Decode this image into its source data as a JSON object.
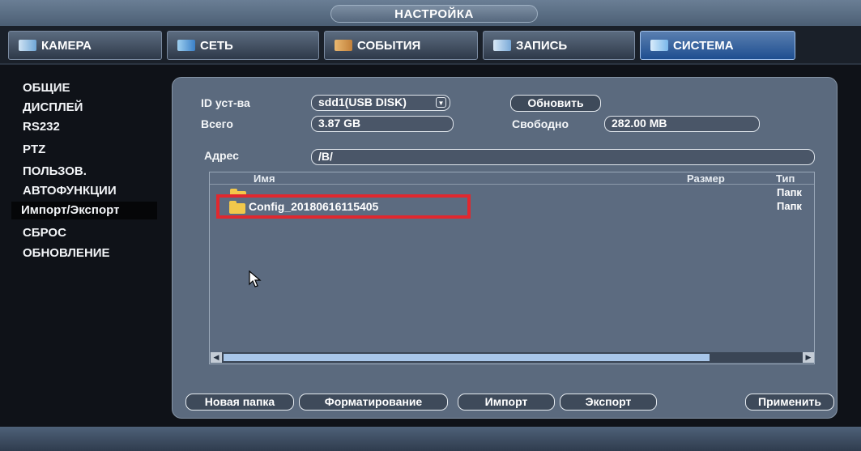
{
  "window": {
    "title": "НАСТРОЙКА"
  },
  "tabs": [
    {
      "label": "КАМЕРА",
      "icon": "camera-icon",
      "active": false
    },
    {
      "label": "СЕТЬ",
      "icon": "network-icon",
      "active": false
    },
    {
      "label": "СОБЫТИЯ",
      "icon": "events-icon",
      "active": false
    },
    {
      "label": "ЗАПИСЬ",
      "icon": "record-icon",
      "active": false
    },
    {
      "label": "СИСТЕМА",
      "icon": "system-icon",
      "active": true
    }
  ],
  "sidebar": {
    "items": [
      {
        "label": "ОБЩИЕ"
      },
      {
        "label": "ДИСПЛЕЙ"
      },
      {
        "label": "RS232"
      },
      {
        "label": "PTZ"
      },
      {
        "label": "ПОЛЬЗОВ."
      },
      {
        "label": "АВТОФУНКЦИИ"
      },
      {
        "label": "Импорт/Экспорт",
        "selected": true
      },
      {
        "label": "СБРОС"
      },
      {
        "label": "ОБНОВЛЕНИЕ"
      }
    ]
  },
  "device": {
    "id_label": "ID уст-ва",
    "id_value": "sdd1(USB DISK)",
    "refresh_label": "Обновить",
    "total_label": "Всего",
    "total_value": "3.87 GB",
    "free_label": "Свободно",
    "free_value": "282.00 MB",
    "address_label": "Адрес",
    "address_value": "/B/"
  },
  "file_list": {
    "columns": {
      "name": "Имя",
      "size": "Размер",
      "type": "Тип"
    },
    "rows": [
      {
        "name": "",
        "size": "",
        "type": "Папк",
        "icon": "folder-icon"
      },
      {
        "name": "Config_20180616115405",
        "size": "",
        "type": "Папк",
        "icon": "folder-icon",
        "highlighted": true
      }
    ]
  },
  "actions": {
    "new_folder": "Новая папка",
    "format": "Форматирование",
    "import": "Импорт",
    "export": "Экспорт",
    "apply": "Применить"
  },
  "colors": {
    "highlight": "#e0282f",
    "folder": "#f2c84b",
    "active_tab": "#1e4e90",
    "panel": "#5b6a7e"
  }
}
